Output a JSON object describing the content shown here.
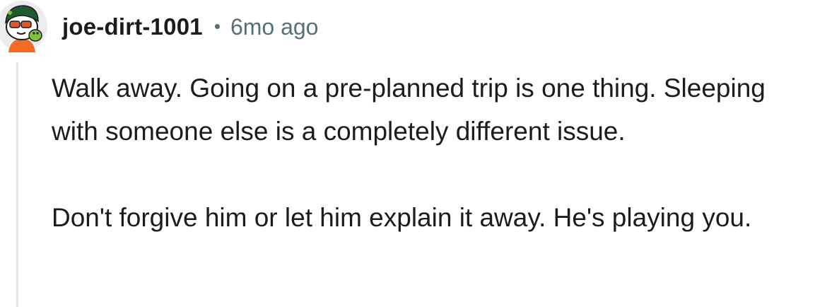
{
  "comment": {
    "author": "joe-dirt-1001",
    "separator": "•",
    "time_ago": "6mo ago",
    "avatar": {
      "icon": "snoo-avatar-icon",
      "colors": {
        "head": "#ffffff",
        "helmet": "#1f5b2e",
        "glasses": "#e8542a",
        "accent": "#7fc241",
        "shirt": "#f26b21"
      }
    },
    "paragraphs": [
      "Walk away. Going on a pre-planned trip is one thing. Sleeping with someone else is a completely different issue.",
      "Don't forgive him or let him explain it away. He's playing you."
    ]
  }
}
